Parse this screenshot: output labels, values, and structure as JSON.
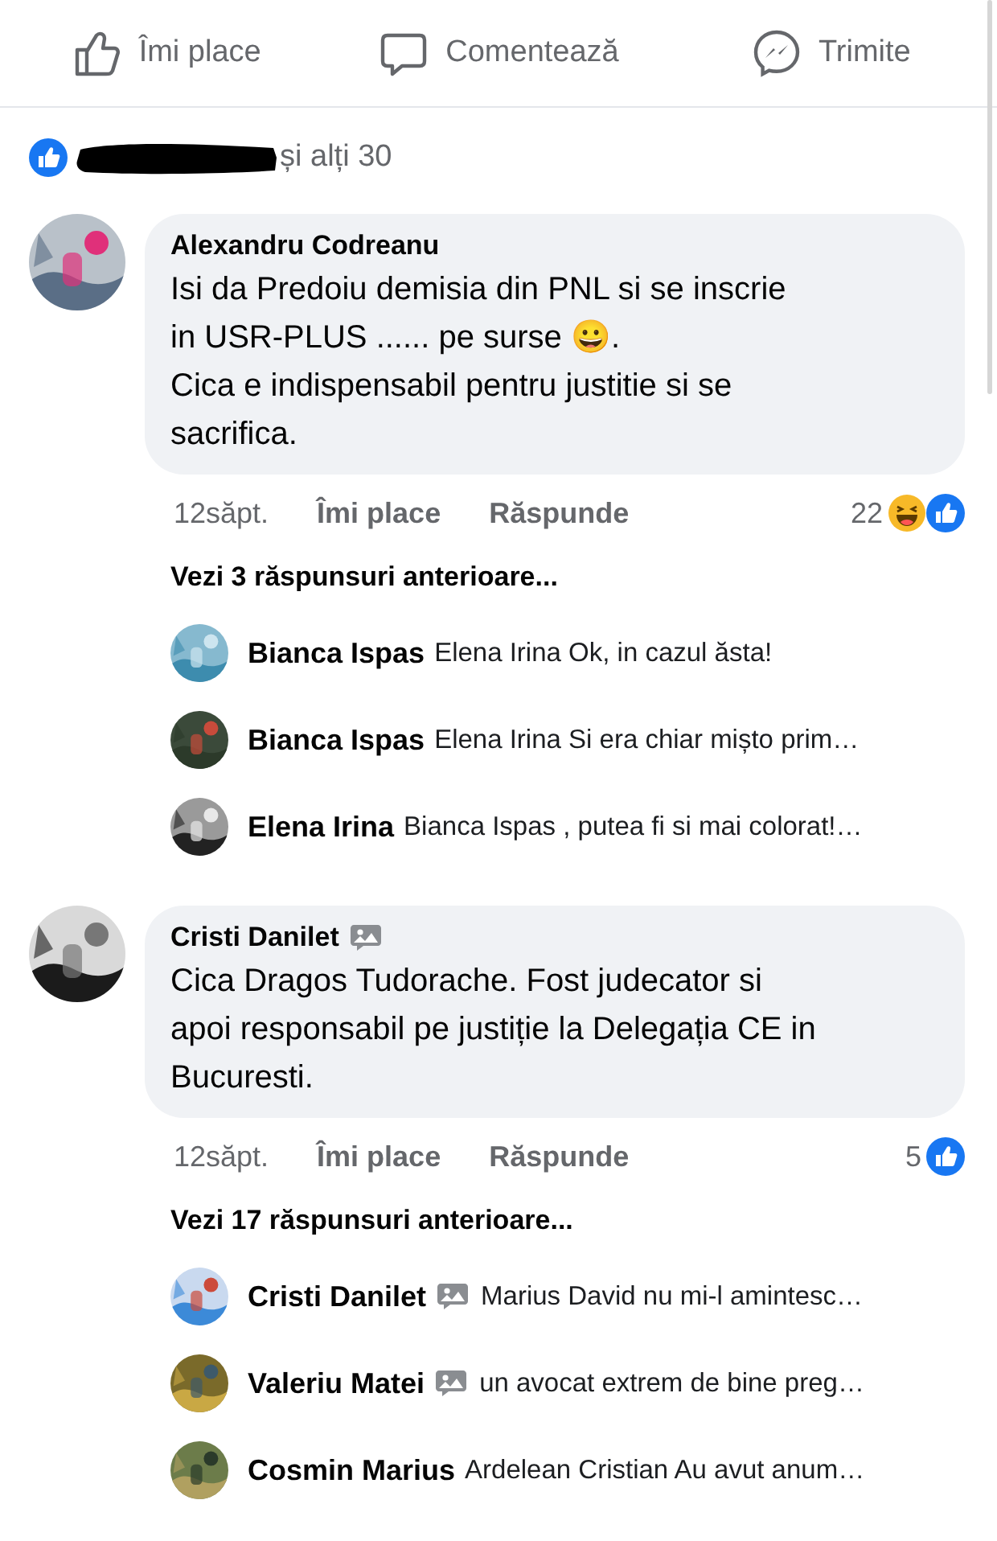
{
  "actions": [
    {
      "kind": "like",
      "label": "Îmi place"
    },
    {
      "kind": "comment",
      "label": "Comentează"
    },
    {
      "kind": "share",
      "label": "Trimite"
    }
  ],
  "reactions": {
    "redacted": true,
    "text": "și alți 30"
  },
  "comments": [
    {
      "author": "Alexandru Codreanu",
      "photo_badge": false,
      "text": "Isi da Predoiu demisia din PNL si se inscrie\nin USR-PLUS ...... pe surse 😀.\nCica e indispensabil pentru justitie si se\nsacrifica.",
      "time": "12săpt.",
      "like": "Îmi place",
      "reply": "Răspunde",
      "count": "22",
      "reaction_icons": [
        {
          "kind": "haha"
        },
        {
          "kind": "like"
        }
      ],
      "more_replies": "Vezi 3 răspunsuri anterioare...",
      "replies": [
        {
          "author": "Bianca Ispas",
          "photo_badge": false,
          "text": "Elena Irina Ok, in cazul ăsta!"
        },
        {
          "author": "Bianca Ispas",
          "photo_badge": false,
          "text": "Elena Irina Si era chiar mișto prim…"
        },
        {
          "author": "Elena Irina",
          "photo_badge": false,
          "text": "Bianca Ispas , putea fi si mai colorat!…"
        }
      ]
    },
    {
      "author": "Cristi Danilet",
      "photo_badge": true,
      "text": "Cica Dragos Tudorache. Fost judecator si\napoi responsabil pe justiție la Delegația CE in\nBucuresti.",
      "time": "12săpt.",
      "like": "Îmi place",
      "reply": "Răspunde",
      "count": "5",
      "reaction_icons": [
        {
          "kind": "like"
        }
      ],
      "more_replies": "Vezi 17 răspunsuri anterioare...",
      "replies": [
        {
          "author": "Cristi Danilet",
          "photo_badge": true,
          "text": "Marius David nu mi-l amintesc…"
        },
        {
          "author": "Valeriu Matei",
          "photo_badge": true,
          "text": "un avocat extrem de bine preg…"
        },
        {
          "author": "Cosmin Marius",
          "photo_badge": false,
          "text": "Ardelean Cristian Au avut anum…"
        }
      ]
    }
  ]
}
